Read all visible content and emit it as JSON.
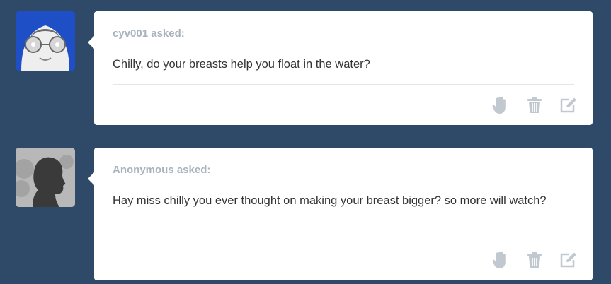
{
  "posts": [
    {
      "asker": "cyv001 asked:",
      "question": "Chilly, do your breasts help you float in the water?",
      "avatar": "custom-cartoon-avatar",
      "actions": [
        "block-hand-icon",
        "trash-icon",
        "edit-icon"
      ]
    },
    {
      "asker": "Anonymous asked:",
      "question": "Hay miss chilly you ever thought on making your breast bigger? so more will watch?",
      "avatar": "anonymous-silhouette-avatar",
      "actions": [
        "block-hand-icon",
        "trash-icon",
        "edit-icon"
      ]
    }
  ],
  "colors": {
    "background": "#2e4a68",
    "card": "#ffffff",
    "asker_text": "#a8b3bd",
    "question_text": "#333333",
    "icon": "#c2c8cf",
    "avatar1_bg": "#1f4fc7"
  }
}
